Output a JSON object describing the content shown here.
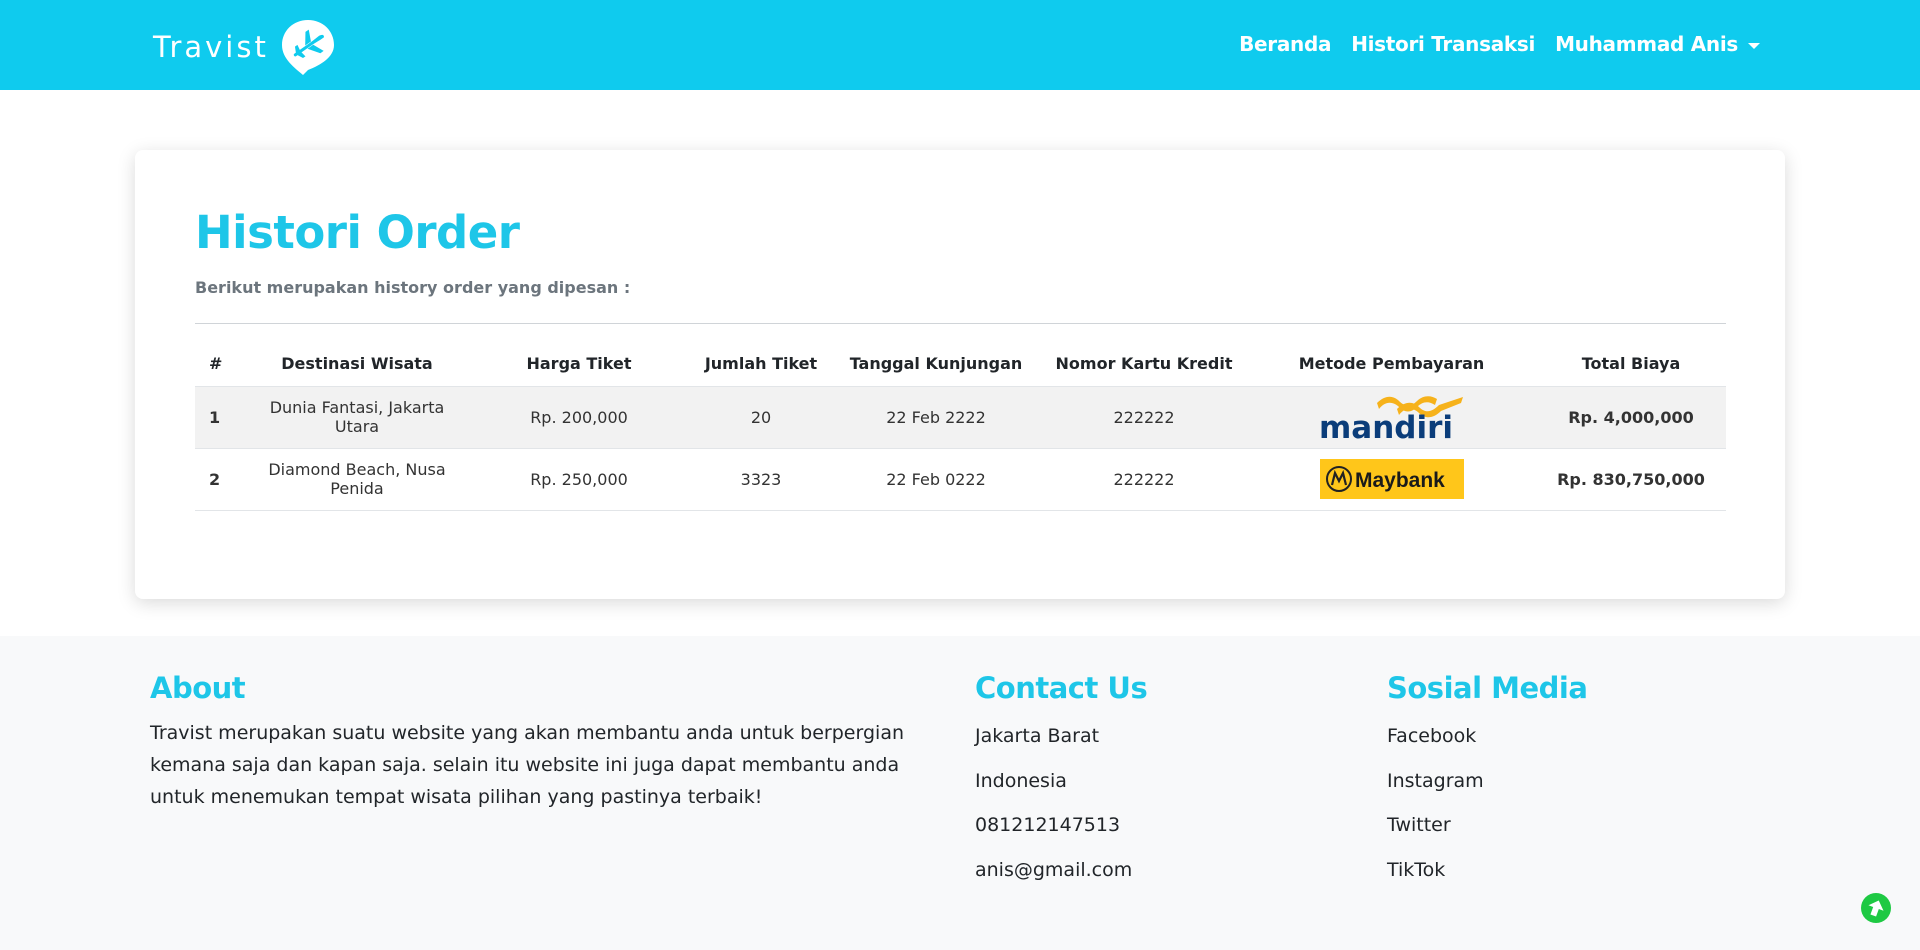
{
  "navbar": {
    "brand": "Travist",
    "links": [
      "Beranda",
      "Histori Transaksi"
    ],
    "user_menu": "Muhammad Anis"
  },
  "main": {
    "title": "Histori Order",
    "subtitle": "Berikut merupakan history order yang dipesan :",
    "table": {
      "headers": [
        "#",
        "Destinasi Wisata",
        "Harga Tiket",
        "Jumlah Tiket",
        "Tanggal Kunjungan",
        "Nomor Kartu Kredit",
        "Metode Pembayaran",
        "Total Biaya"
      ],
      "rows": [
        {
          "no": "1",
          "destination": "Dunia Fantasi, Jakarta Utara",
          "price": "Rp. 200,000",
          "qty": "20",
          "date": "22 Feb 2222",
          "card": "222222",
          "payment": "mandiri",
          "total": "Rp. 4,000,000"
        },
        {
          "no": "2",
          "destination": "Diamond Beach, Nusa Penida",
          "price": "Rp. 250,000",
          "qty": "3323",
          "date": "22 Feb 0222",
          "card": "222222",
          "payment": "Maybank",
          "total": "Rp. 830,750,000"
        }
      ]
    }
  },
  "footer": {
    "about": {
      "title": "About",
      "text": "Travist merupakan suatu website yang akan membantu anda untuk berpergian kemana saja dan kapan saja. selain itu website ini juga dapat membantu anda untuk menemukan tempat wisata pilihan yang pastinya terbaik!"
    },
    "contact": {
      "title": "Contact Us",
      "items": [
        "Jakarta Barat",
        "Indonesia",
        "081212147513",
        "anis@gmail.com"
      ]
    },
    "social": {
      "title": "Sosial Media",
      "items": [
        "Facebook",
        "Instagram",
        "Twitter",
        "TikTok"
      ]
    }
  },
  "colors": {
    "navbar": "#0fcbee",
    "accent": "#1ec6e8",
    "total_text": "#1e7e4a",
    "maybank_yellow": "#ffc61a",
    "mandiri_blue": "#0b3d7a",
    "mandiri_gold": "#f6b21b",
    "scroll_button": "#1ec943"
  },
  "icons": {
    "brand_logo": "plane-pin-icon",
    "user_caret": "caret-down-icon",
    "scroll_top": "arrow-up-circle-icon"
  }
}
